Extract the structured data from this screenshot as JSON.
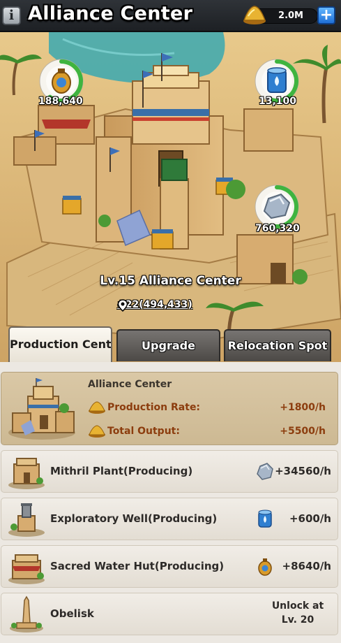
{
  "header": {
    "info_icon": "i",
    "title": "Alliance Center",
    "currency_icon": "gold-pile-icon",
    "currency_value": "2.0M",
    "add_icon": "+"
  },
  "scene": {
    "resources": [
      {
        "icon": "sacred-water-bottle-icon",
        "value": "188,640",
        "ring_fraction": 0.6
      },
      {
        "icon": "water-barrel-icon",
        "value": "13,100",
        "ring_fraction": 0.55
      },
      {
        "icon": "mithril-ore-icon",
        "value": "760,320",
        "ring_fraction": 0.55
      }
    ],
    "building_name": "Lv.15 Alliance Center",
    "coordinates": "#22(494,433)",
    "pin_icon": "location-pin-icon"
  },
  "tabs": [
    {
      "label": "Production Center",
      "active": true
    },
    {
      "label": "Upgrade",
      "active": false
    },
    {
      "label": "Relocation Spot",
      "active": false
    }
  ],
  "featured": {
    "name": "Alliance Center",
    "stats": [
      {
        "icon": "gold-pile-icon",
        "label": "Production Rate:",
        "value": "+1800/h"
      },
      {
        "icon": "gold-pile-icon",
        "label": "Total Output:",
        "value": "+5500/h"
      }
    ]
  },
  "rows": [
    {
      "name": "Mithril Plant(Producing)",
      "icon": "mithril-ore-icon",
      "rate": "+34560/h"
    },
    {
      "name": "Exploratory Well(Producing)",
      "icon": "water-barrel-icon",
      "rate": "+600/h"
    },
    {
      "name": "Sacred Water Hut(Producing)",
      "icon": "sacred-water-bottle-icon",
      "rate": "+8640/h"
    },
    {
      "name": "Obelisk",
      "unlock": "Unlock at Lv. 20"
    }
  ],
  "colors": {
    "accent_blue": "#1f6fd6",
    "progress_green": "#3fb43f",
    "stat_text": "#8c3d0e",
    "sand": "#d9b77a"
  }
}
